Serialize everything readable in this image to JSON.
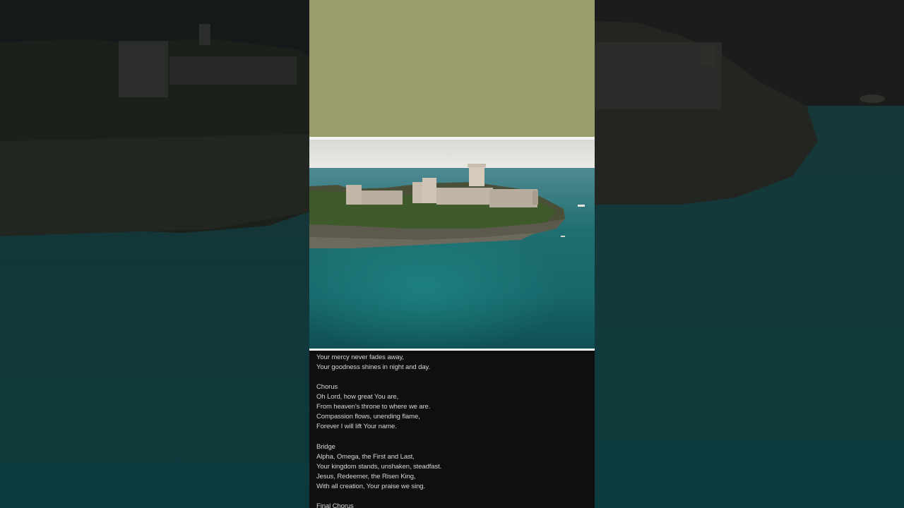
{
  "video": {
    "lyrics": [
      "Your mercy never fades away,",
      "Your goodness shines in night and day.",
      "",
      "Chorus",
      "Oh Lord, how great You are,",
      "From heaven's throne to where we are.",
      "Compassion flows, unending flame,",
      "Forever I will lift Your name.",
      "",
      "Bridge",
      "Alpha, Omega, the First and Last,",
      "Your kingdom stands, unshaken, steadfast.",
      "Jesus, Redeemer, the Risen King,",
      "With all creation, Your praise we sing.",
      "",
      "Final Chorus"
    ]
  },
  "colors": {
    "top_block": "#9a9e6e",
    "background": "#0b0d0e",
    "lyrics_panel": "#0f0f11",
    "lyric_text": "#d6d6d6",
    "sea": "#1c6a6c"
  }
}
